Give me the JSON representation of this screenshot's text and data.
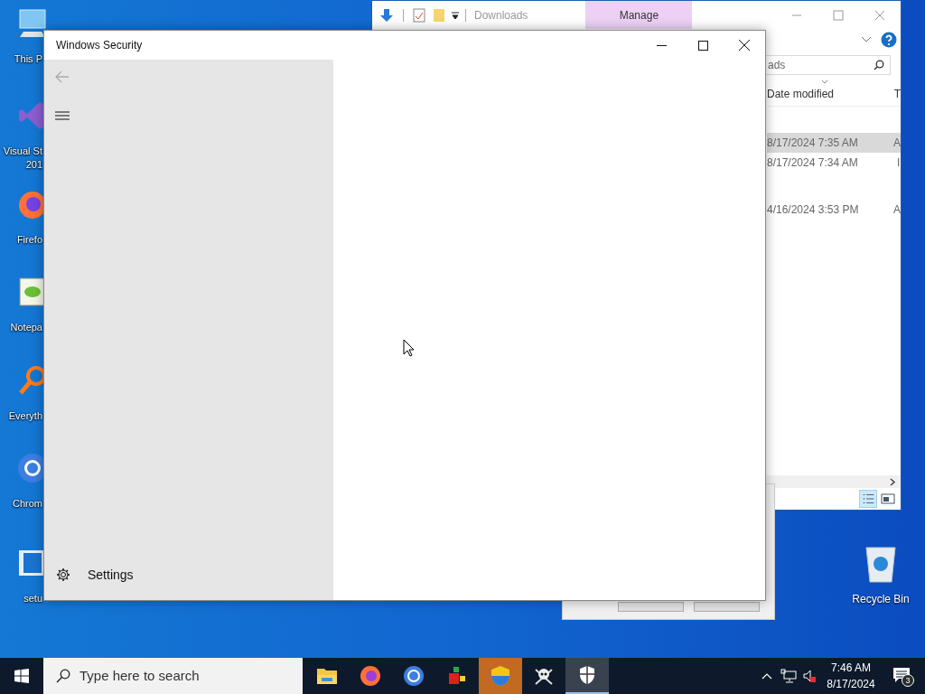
{
  "desktop_icons": [
    {
      "kind": "computer",
      "lines": [
        "This P"
      ]
    },
    {
      "kind": "studio",
      "lines": [
        "Visual St",
        "201"
      ]
    },
    {
      "kind": "firefox",
      "lines": [
        "Firefo"
      ]
    },
    {
      "kind": "notepad",
      "lines": [
        "Notepa"
      ]
    },
    {
      "kind": "everything",
      "lines": [
        "Everyth"
      ]
    },
    {
      "kind": "chrome",
      "lines": [
        "Chrom"
      ]
    },
    {
      "kind": "setup",
      "lines": [
        "setu"
      ]
    }
  ],
  "recycle_bin": {
    "label": "Recycle Bin"
  },
  "explorer": {
    "title": "Downloads",
    "ribbon_tab": "Manage",
    "search_value": "ads",
    "columns": [
      "Date modified",
      "T"
    ],
    "rows": [
      {
        "date": "8/17/2024 7:35 AM",
        "column_3": "A",
        "selected": true
      },
      {
        "date": "8/17/2024 7:34 AM",
        "column_3": "I",
        "selected": false
      },
      {
        "date": "4/16/2024 3:53 PM",
        "column_3": "A",
        "selected": false
      }
    ]
  },
  "security_window": {
    "title": "Windows Security",
    "back_disabled": true,
    "settings_label": "Settings"
  },
  "taskbar": {
    "search_placeholder": "Type here to search",
    "apps": [
      {
        "kind": "explorer",
        "selected": false,
        "flashing": false
      },
      {
        "kind": "firefox",
        "selected": false,
        "flashing": false
      },
      {
        "kind": "chrome",
        "selected": false,
        "flashing": false
      },
      {
        "kind": "blocks",
        "selected": false,
        "flashing": false
      },
      {
        "kind": "uac",
        "selected": false,
        "flashing": true
      },
      {
        "kind": "pirate",
        "selected": false,
        "flashing": false
      },
      {
        "kind": "defender",
        "selected": true,
        "flashing": false
      }
    ],
    "time": "7:46 AM",
    "date": "8/17/2024",
    "notification_count": "3"
  }
}
